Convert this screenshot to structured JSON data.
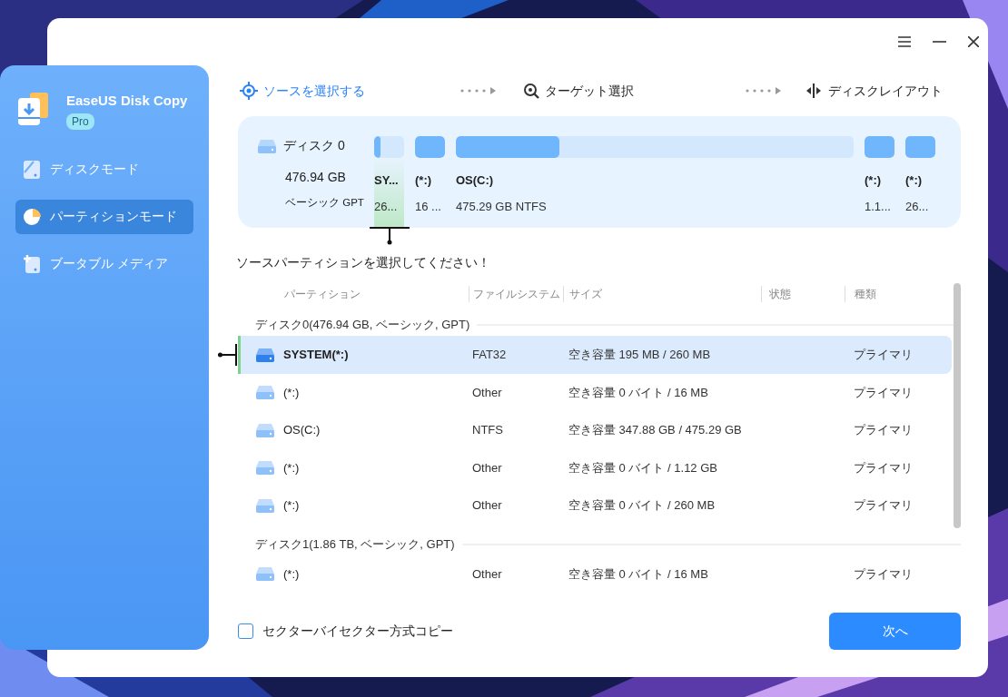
{
  "sidebar": {
    "app_name": "EaseUS Disk Copy",
    "edition": "Pro",
    "items": [
      {
        "label": "ディスクモード",
        "selected": false
      },
      {
        "label": "パーティションモード",
        "selected": true
      },
      {
        "label": "ブータブル メディア",
        "selected": false
      }
    ]
  },
  "steps": [
    {
      "label": "ソースを選択する",
      "selected": true
    },
    {
      "label": "ターゲット選択",
      "selected": false
    },
    {
      "label": "ディスクレイアウト",
      "selected": false
    }
  ],
  "disk": {
    "name": "ディスク 0",
    "size": "476.94 GB",
    "type": "ベーシック GPT",
    "segments": [
      {
        "label": "SY...",
        "size": "26...",
        "level": 0.2,
        "selected": true
      },
      {
        "label": "(*:)",
        "size": "16 ...",
        "level": 1,
        "selected": false
      },
      {
        "label": "OS(C:)",
        "size": "475.29 GB NTFS",
        "level": 0.26,
        "selected": false
      },
      {
        "label": "(*:)",
        "size": "1.1...",
        "level": 1,
        "selected": false
      },
      {
        "label": "(*:)",
        "size": "26...",
        "level": 1,
        "selected": false
      }
    ]
  },
  "prompt": "ソースパーティションを選択してください！",
  "table": {
    "columns": [
      "パーティション",
      "ファイルシステム",
      "サイズ",
      "状態",
      "種類"
    ],
    "groups": [
      {
        "title": "ディスク0(476.94 GB, ベーシック, GPT)",
        "rows": [
          {
            "name": "SYSTEM(*:)",
            "filesystem": "FAT32",
            "size": "空き容量 195 MB / 260 MB",
            "type": "プライマリ",
            "selected": true
          },
          {
            "name": "(*:)",
            "filesystem": "Other",
            "size": "空き容量 0 バイト / 16 MB",
            "type": "プライマリ",
            "selected": false
          },
          {
            "name": "OS(C:)",
            "filesystem": "NTFS",
            "size": "空き容量 347.88 GB / 475.29 GB",
            "type": "プライマリ",
            "selected": false
          },
          {
            "name": "(*:)",
            "filesystem": "Other",
            "size": "空き容量 0 バイト / 1.12 GB",
            "type": "プライマリ",
            "selected": false
          },
          {
            "name": "(*:)",
            "filesystem": "Other",
            "size": "空き容量 0 バイト / 260 MB",
            "type": "プライマリ",
            "selected": false
          }
        ]
      },
      {
        "title": "ディスク1(1.86 TB, ベーシック, GPT)",
        "rows": [
          {
            "name": "(*:)",
            "filesystem": "Other",
            "size": "空き容量 0 バイト / 16 MB",
            "type": "プライマリ",
            "selected": false
          }
        ]
      }
    ]
  },
  "sector_copy": {
    "label": "セクターバイセクター方式コピー",
    "checked": false
  },
  "next_button": "次へ"
}
